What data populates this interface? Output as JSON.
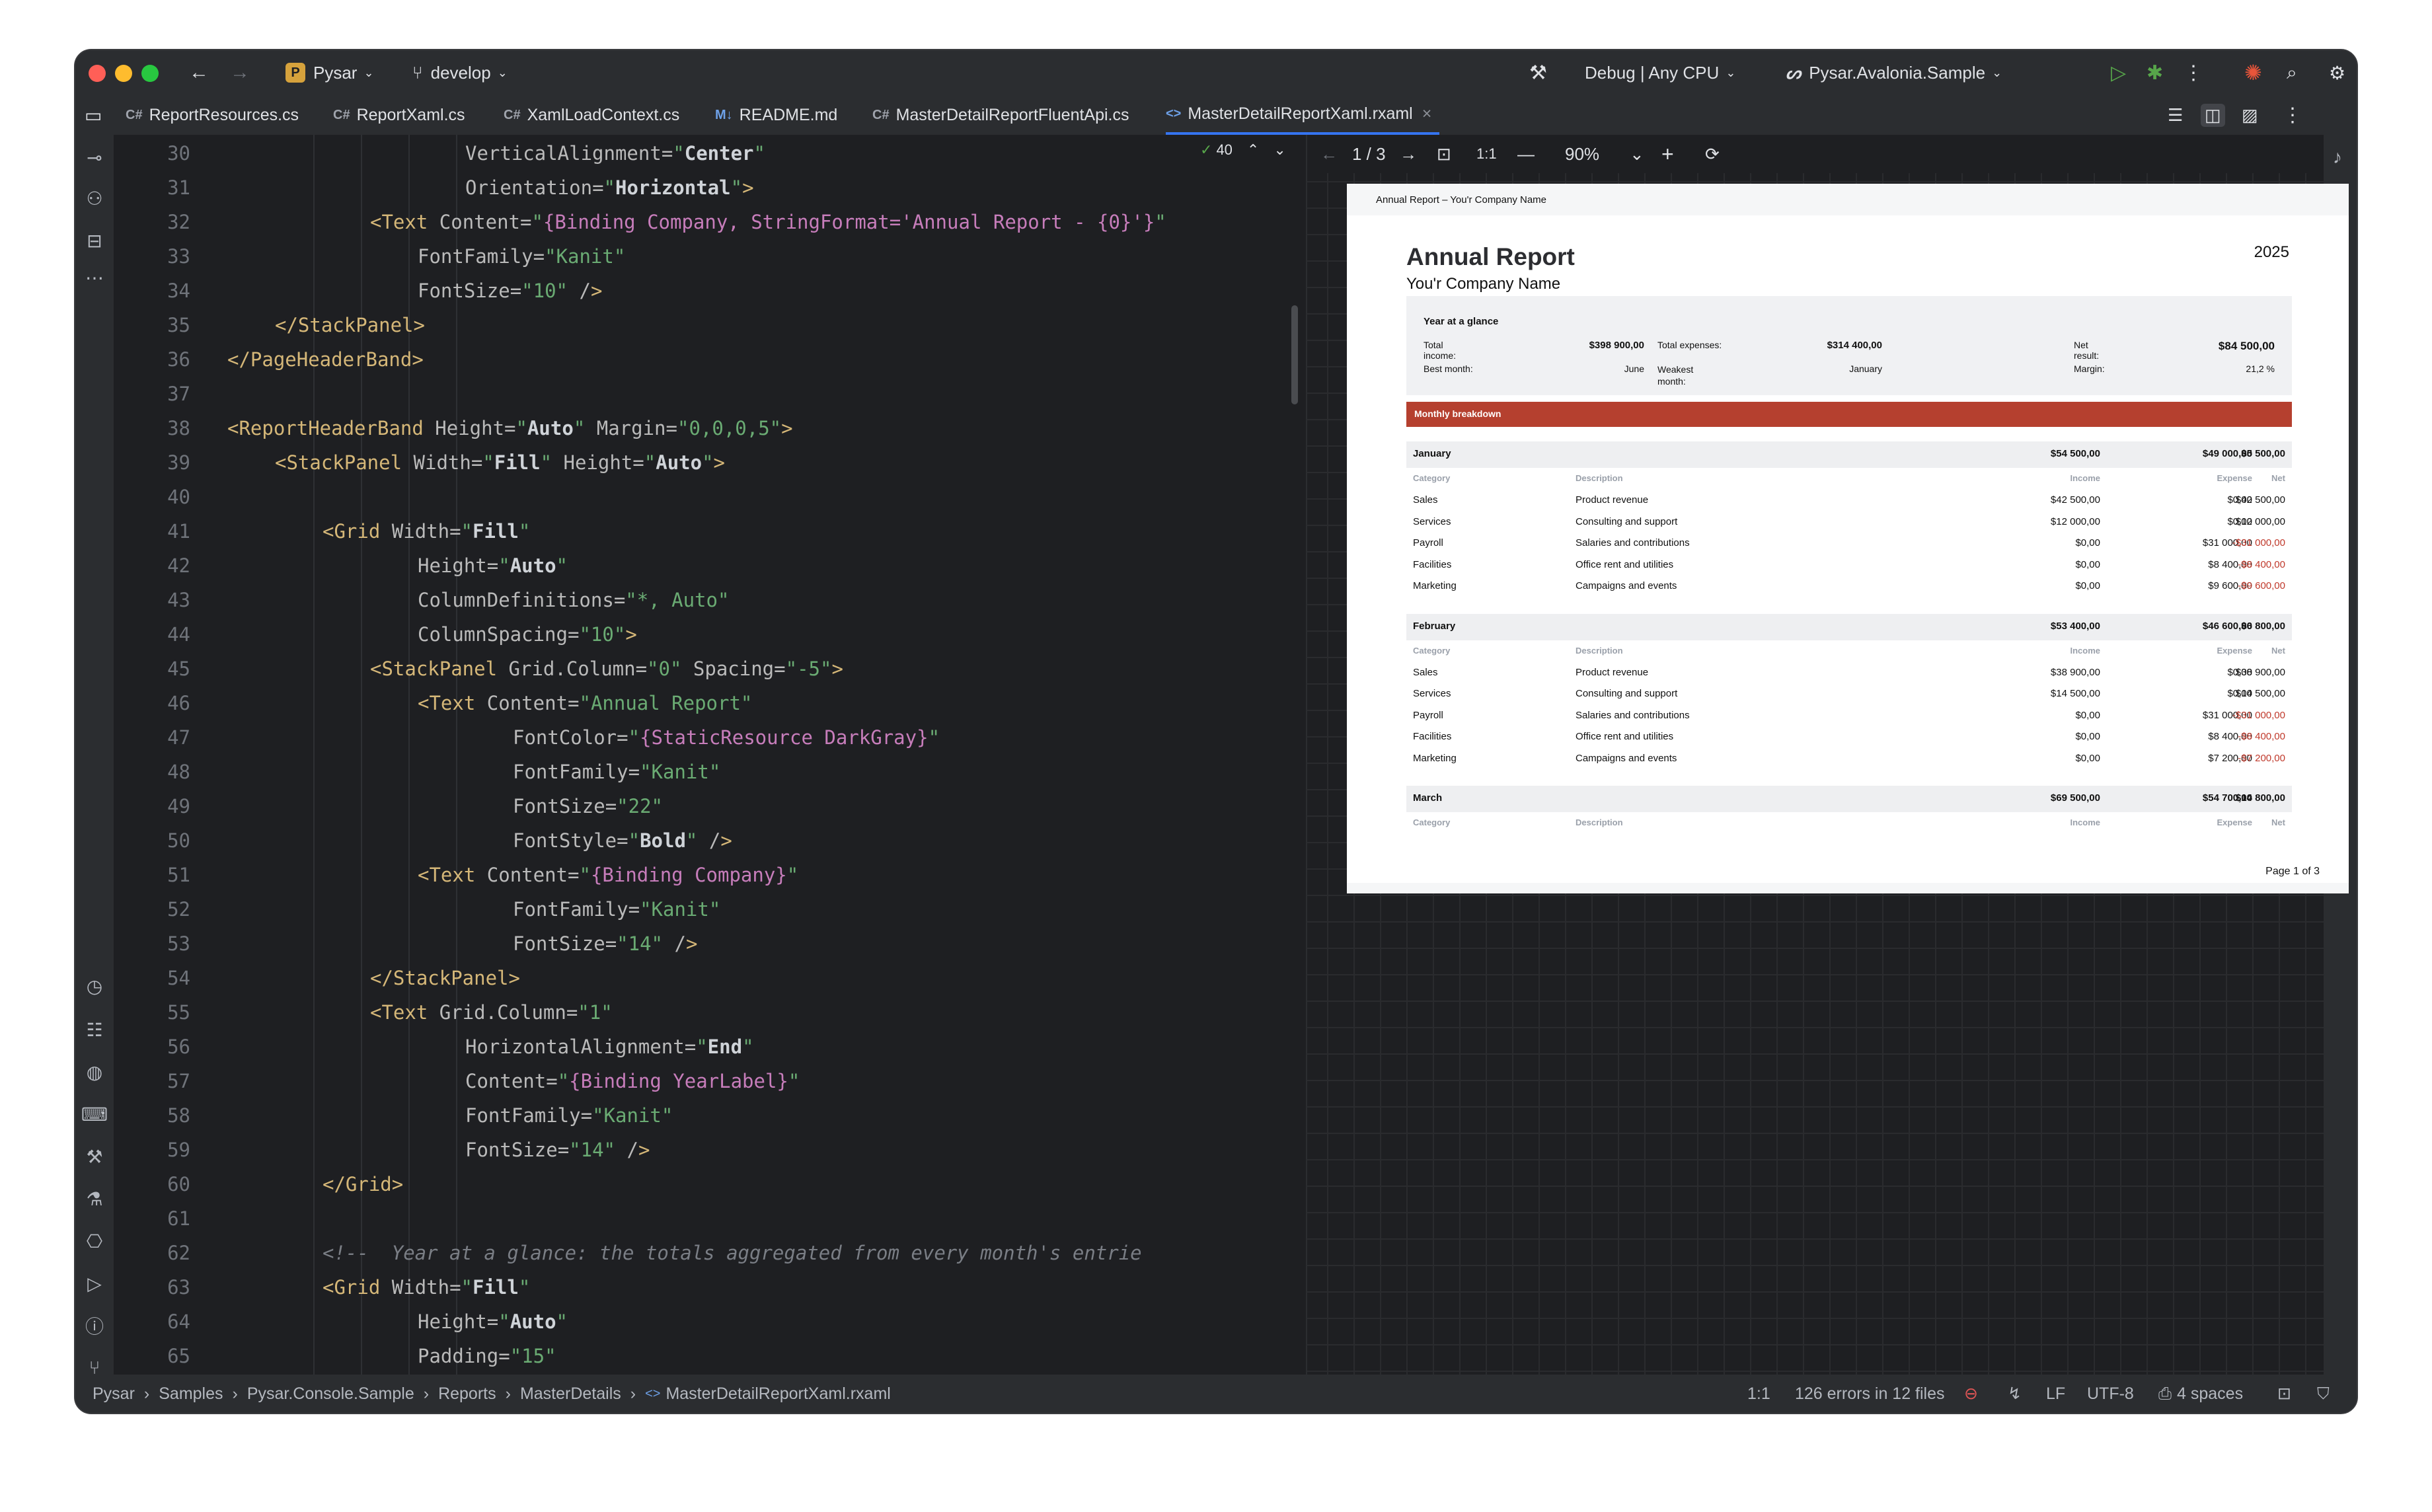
{
  "titlebar": {
    "project_badge": "P",
    "project": "Pysar",
    "branch": "develop",
    "config": "Debug | Any CPU",
    "run_target": "Pysar.Avalonia.Sample"
  },
  "tabs": [
    {
      "label": "ReportResources.cs",
      "prefix": "C#"
    },
    {
      "label": "ReportXaml.cs",
      "prefix": "C#"
    },
    {
      "label": "XamlLoadContext.cs",
      "prefix": "C#"
    },
    {
      "label": "README.md",
      "prefix": "M↓"
    },
    {
      "label": "MasterDetailReportFluentApi.cs",
      "prefix": "C#"
    },
    {
      "label": "MasterDetailReportXaml.rxaml",
      "prefix": "<>"
    }
  ],
  "editor": {
    "warnings": "40",
    "lines": [
      {
        "n": "30",
        "indent": 6,
        "text": "VerticalAlignment=\"Center\""
      },
      {
        "n": "31",
        "indent": 6,
        "text": "Orientation=\"Horizontal\">"
      },
      {
        "n": "32",
        "indent": 4,
        "text": "<Text Content=\"{Binding Company, StringFormat='Annual Report - {0}'}\""
      },
      {
        "n": "33",
        "indent": 5,
        "text": "FontFamily=\"Kanit\""
      },
      {
        "n": "34",
        "indent": 5,
        "text": "FontSize=\"10\" />"
      },
      {
        "n": "35",
        "indent": 2,
        "text": "</StackPanel>"
      },
      {
        "n": "36",
        "indent": 1,
        "text": "</PageHeaderBand>"
      },
      {
        "n": "37",
        "indent": 0,
        "text": ""
      },
      {
        "n": "38",
        "indent": 1,
        "text": "<ReportHeaderBand Height=\"Auto\" Margin=\"0,0,0,5\">"
      },
      {
        "n": "39",
        "indent": 2,
        "text": "<StackPanel Width=\"Fill\" Height=\"Auto\">"
      },
      {
        "n": "40",
        "indent": 0,
        "text": ""
      },
      {
        "n": "41",
        "indent": 3,
        "text": "<Grid Width=\"Fill\""
      },
      {
        "n": "42",
        "indent": 5,
        "text": "Height=\"Auto\""
      },
      {
        "n": "43",
        "indent": 5,
        "text": "ColumnDefinitions=\"*, Auto\""
      },
      {
        "n": "44",
        "indent": 5,
        "text": "ColumnSpacing=\"10\">"
      },
      {
        "n": "45",
        "indent": 4,
        "text": "<StackPanel Grid.Column=\"0\" Spacing=\"-5\">"
      },
      {
        "n": "46",
        "indent": 5,
        "text": "<Text Content=\"Annual Report\""
      },
      {
        "n": "47",
        "indent": 7,
        "text": "FontColor=\"{StaticResource DarkGray}\""
      },
      {
        "n": "48",
        "indent": 7,
        "text": "FontFamily=\"Kanit\""
      },
      {
        "n": "49",
        "indent": 7,
        "text": "FontSize=\"22\""
      },
      {
        "n": "50",
        "indent": 7,
        "text": "FontStyle=\"Bold\" />"
      },
      {
        "n": "51",
        "indent": 5,
        "text": "<Text Content=\"{Binding Company}\""
      },
      {
        "n": "52",
        "indent": 7,
        "text": "FontFamily=\"Kanit\""
      },
      {
        "n": "53",
        "indent": 7,
        "text": "FontSize=\"14\" />"
      },
      {
        "n": "54",
        "indent": 4,
        "text": "</StackPanel>"
      },
      {
        "n": "55",
        "indent": 4,
        "text": "<Text Grid.Column=\"1\""
      },
      {
        "n": "56",
        "indent": 6,
        "text": "HorizontalAlignment=\"End\""
      },
      {
        "n": "57",
        "indent": 6,
        "text": "Content=\"{Binding YearLabel}\""
      },
      {
        "n": "58",
        "indent": 6,
        "text": "FontFamily=\"Kanit\""
      },
      {
        "n": "59",
        "indent": 6,
        "text": "FontSize=\"14\" />"
      },
      {
        "n": "60",
        "indent": 3,
        "text": "</Grid>"
      },
      {
        "n": "61",
        "indent": 0,
        "text": ""
      },
      {
        "n": "62",
        "indent": 3,
        "text": "<!--  Year at a glance: the totals aggregated from every month's entrie"
      },
      {
        "n": "63",
        "indent": 3,
        "text": "<Grid Width=\"Fill\""
      },
      {
        "n": "64",
        "indent": 5,
        "text": "Height=\"Auto\""
      },
      {
        "n": "65",
        "indent": 5,
        "text": "Padding=\"15\""
      }
    ]
  },
  "preview": {
    "page_indicator": "1 / 3",
    "ratio": "1:1",
    "zoom": "90%",
    "report": {
      "header": "Annual Report – You'r Company Name",
      "title": "Annual Report",
      "company": "You'r Company Name",
      "year": "2025",
      "glance": {
        "title": "Year at a glance",
        "total_income_label": "Total income:",
        "total_income": "$398 900,00",
        "total_expenses_label": "Total expenses:",
        "total_expenses": "$314 400,00",
        "net_label": "Net result:",
        "net": "$84 500,00",
        "best_month_label": "Best month:",
        "best_month": "June",
        "weakest_label": "Weakest month:",
        "weakest": "January",
        "margin_label": "Margin:",
        "margin": "21,2 %"
      },
      "breakdown_title": "Monthly breakdown",
      "col_headers": {
        "category": "Category",
        "description": "Description",
        "income": "Income",
        "expense": "Expense",
        "net": "Net"
      },
      "months": [
        {
          "name": "January",
          "income": "$54 500,00",
          "expense": "$49 000,00",
          "net": "$5 500,00",
          "rows": [
            {
              "c": "Sales",
              "d": "Product revenue",
              "i": "$42 500,00",
              "e": "$0,00",
              "n": "$42 500,00",
              "neg": false
            },
            {
              "c": "Services",
              "d": "Consulting and support",
              "i": "$12 000,00",
              "e": "$0,00",
              "n": "$12 000,00",
              "neg": false
            },
            {
              "c": "Payroll",
              "d": "Salaries and contributions",
              "i": "$0,00",
              "e": "$31 000,00",
              "n": "-$31 000,00",
              "neg": true
            },
            {
              "c": "Facilities",
              "d": "Office rent and utilities",
              "i": "$0,00",
              "e": "$8 400,00",
              "n": "-$8 400,00",
              "neg": true
            },
            {
              "c": "Marketing",
              "d": "Campaigns and events",
              "i": "$0,00",
              "e": "$9 600,00",
              "n": "-$9 600,00",
              "neg": true
            }
          ]
        },
        {
          "name": "February",
          "income": "$53 400,00",
          "expense": "$46 600,00",
          "net": "$6 800,00",
          "rows": [
            {
              "c": "Sales",
              "d": "Product revenue",
              "i": "$38 900,00",
              "e": "$0,00",
              "n": "$38 900,00",
              "neg": false
            },
            {
              "c": "Services",
              "d": "Consulting and support",
              "i": "$14 500,00",
              "e": "$0,00",
              "n": "$14 500,00",
              "neg": false
            },
            {
              "c": "Payroll",
              "d": "Salaries and contributions",
              "i": "$0,00",
              "e": "$31 000,00",
              "n": "-$31 000,00",
              "neg": true
            },
            {
              "c": "Facilities",
              "d": "Office rent and utilities",
              "i": "$0,00",
              "e": "$8 400,00",
              "n": "-$8 400,00",
              "neg": true
            },
            {
              "c": "Marketing",
              "d": "Campaigns and events",
              "i": "$0,00",
              "e": "$7 200,00",
              "n": "-$7 200,00",
              "neg": true
            }
          ]
        },
        {
          "name": "March",
          "income": "$69 500,00",
          "expense": "$54 700,00",
          "net": "$14 800,00",
          "rows": []
        }
      ],
      "footer": "Page 1 of  3"
    }
  },
  "statusbar": {
    "breadcrumb": [
      "Pysar",
      "Samples",
      "Pysar.Console.Sample",
      "Reports",
      "MasterDetails",
      "MasterDetailReportXaml.rxaml"
    ],
    "position": "1:1",
    "errors": "126 errors in 12 files",
    "line_ending": "LF",
    "encoding": "UTF-8",
    "indent": "4 spaces"
  },
  "colors": {
    "accent": "#3574f0",
    "report_red": "#b5402f",
    "negative": "#c0392b"
  }
}
